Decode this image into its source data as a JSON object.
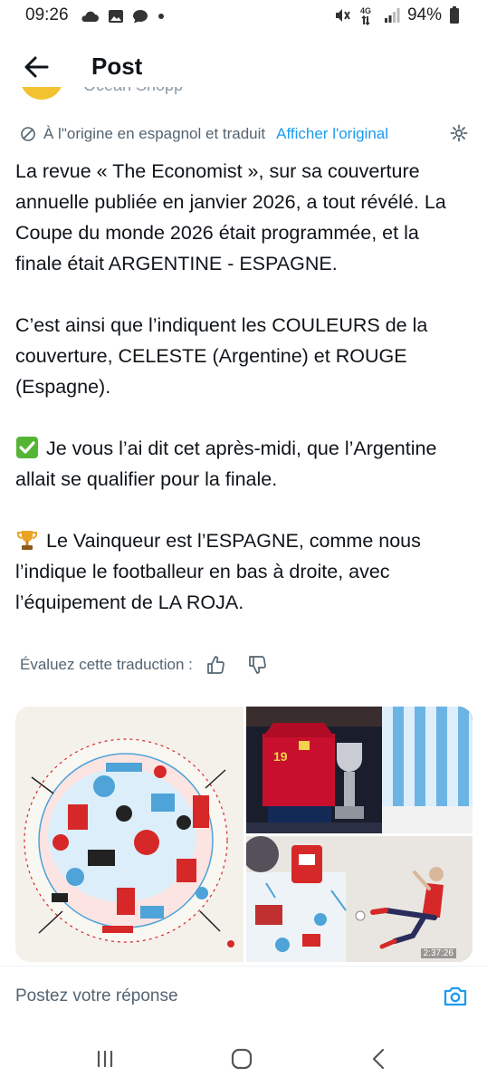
{
  "status": {
    "time": "09:26",
    "network": "4G",
    "battery": "94%"
  },
  "header": {
    "title": "Post"
  },
  "author": {
    "partial_name": "Ocean Shopp"
  },
  "translation": {
    "notice": "À l\"origine en espagnol et traduit",
    "show_original": "Afficher l'original"
  },
  "post": {
    "p1": "La revue « The Economist », sur sa couverture annuelle publiée en janvier 2026, a tout révélé. La Coupe du monde 2026 était programmée, et la finale était ARGENTINE - ESPAGNE.",
    "p2": "C’est ainsi que l’indiquent les COULEURS de la couverture, CELESTE (Argentine) et ROUGE (Espagne).",
    "p3": "Je vous l’ai dit cet après-midi, que l’Argentine allait se qualifier pour la finale.",
    "p4": "Le Vainqueur est l’ESPAGNE, comme nous l’indique le footballeur en bas à droite, avec l’équipement de LA ROJA.",
    "p3_emoji": "check-mark-button",
    "p4_emoji": "trophy"
  },
  "rating": {
    "label": "Évaluez cette traduction :"
  },
  "media": {
    "video_timestamp": "2:37:26",
    "jersey_number": "19"
  },
  "reply": {
    "placeholder": "Postez votre réponse"
  },
  "colors": {
    "accent": "#1d9bf0",
    "celeste": "#4ea3d8",
    "rouge": "#d62828",
    "muted": "#536471"
  }
}
